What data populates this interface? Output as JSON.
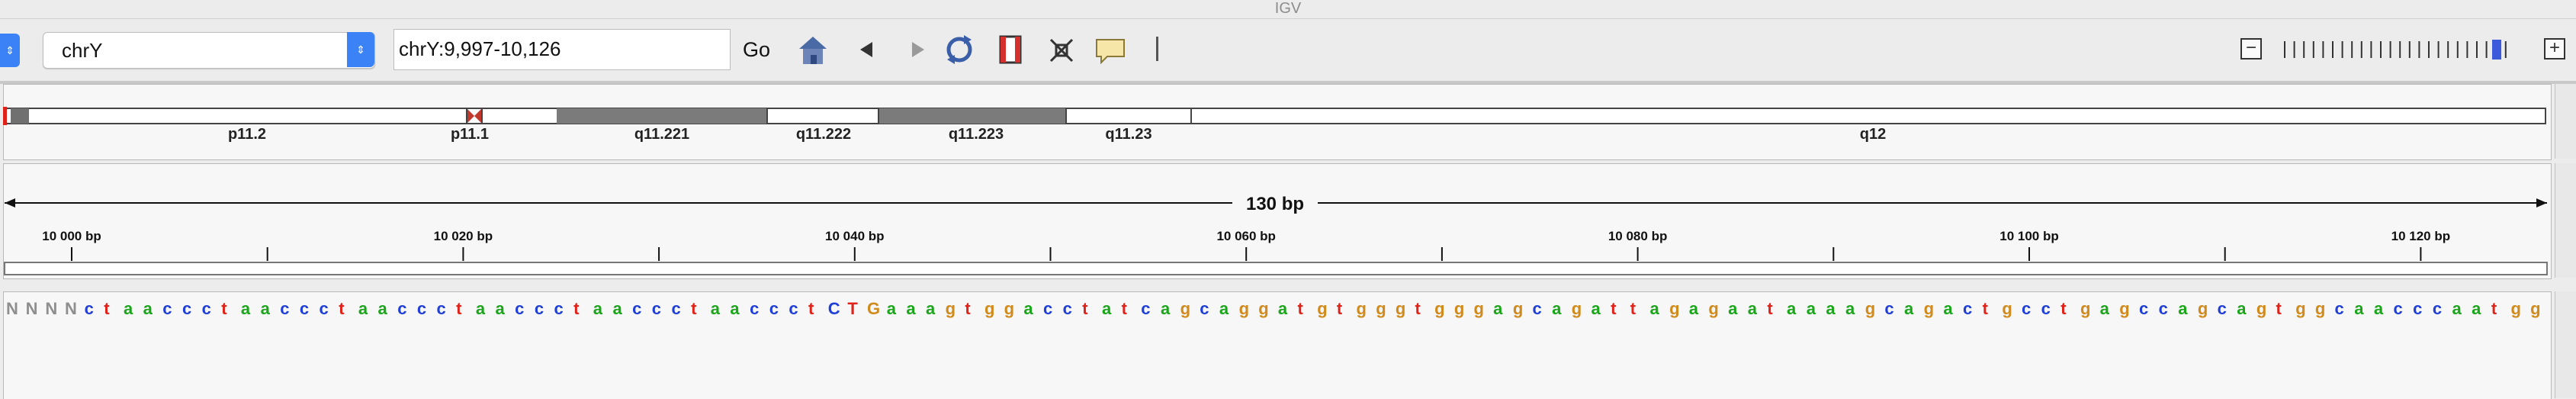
{
  "window_title": "IGV",
  "toolbar": {
    "chromosome": "chrY",
    "locus": "chrY:9,997-10,126",
    "go_label": "Go"
  },
  "cytoband": {
    "bands": [
      "p11.2",
      "p11.1",
      "q11.221",
      "q11.222",
      "q11.223",
      "q11.23",
      "q12"
    ]
  },
  "ruler": {
    "span_label": "130 bp",
    "ticks": [
      "10 000 bp",
      "10 020 bp",
      "10 040 bp",
      "10 060 bp",
      "10 080 bp",
      "10 100 bp",
      "10 120 bp"
    ]
  },
  "sequence": {
    "bases": "NNNNctaaccctaaccctaaccctaaccctaaccctaaccctCTGaaagtggacctatcagcaggatgtgggtgggagcagattagagaataaaagcagactgcctgagccagcagtggcaacccaatgg",
    "colors": {
      "A": "#1aa51a",
      "C": "#1f3fd6",
      "G": "#d18a1c",
      "T": "#e0231a",
      "N": "#8e8e8e"
    }
  },
  "icons": [
    "home-icon",
    "back-icon",
    "forward-icon",
    "refresh-icon",
    "region-icon",
    "resize-icon",
    "popup-icon"
  ]
}
